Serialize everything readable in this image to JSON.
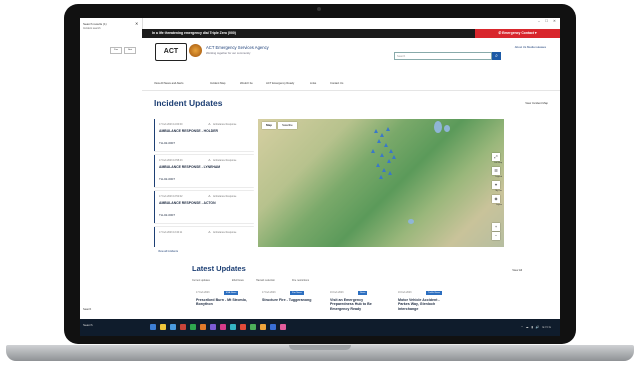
{
  "browser": {
    "left_panel_title": "Search results (1)",
    "left_panel_subtitle": "Incident search",
    "left_panel_buttons": [
      "Prev",
      "Next"
    ],
    "left_panel_footer": "Search",
    "window_controls": "– ☐ ✕"
  },
  "emergency_bar": {
    "text": "In a life threatening emergency dial Triple Zero (000)",
    "button_label": "Emergency Contact"
  },
  "header": {
    "logo_text": "ACT",
    "agency_name": "ACT Emergency Services Agency",
    "agency_tagline": "Working together for our community",
    "links": "About Us   Media releases",
    "search_placeholder": "Search"
  },
  "nav": {
    "items": [
      "View All News and Alerts",
      "Incident Map",
      "Would I be",
      "ACT Emergency Ready",
      "Links",
      "Contact Us"
    ]
  },
  "incidents": {
    "title": "Incident Updates",
    "view_all": "View Incident Map",
    "view_all_incidents": "View all Incidents",
    "cards": [
      {
        "date": "17 Feb 2023 14:00:00",
        "status": "Ambulance Response",
        "name": "AMBULANCE RESPONSE - HOLDER",
        "id": "TH-02-0007"
      },
      {
        "date": "17 Feb 2023 13:58:43",
        "status": "Ambulance Response",
        "name": "AMBULANCE RESPONSE - LYNEHAM",
        "id": "TH-02-0007"
      },
      {
        "date": "17 Feb 2023 13:52:02",
        "status": "Ambulance Response",
        "name": "AMBULANCE RESPONSE - ACTON",
        "id": "TH-02-0007"
      },
      {
        "date": "17 Feb 2023 13:40:11",
        "status": "Ambulance Response",
        "name": "",
        "id": ""
      }
    ]
  },
  "map": {
    "tabs": [
      "Map",
      "Satellite"
    ],
    "controls": [
      "Full Map",
      "Legend",
      "My Loc",
      "Layers"
    ],
    "zoom_in": "+",
    "zoom_out": "−"
  },
  "latest": {
    "title": "Latest Updates",
    "view_all": "View All",
    "filters": [
      "Current updates",
      "ESA News",
      "Hazard reduction",
      "Fire restrictions"
    ],
    "cards": [
      {
        "date": "17 Feb 2023",
        "badge": "ESA News",
        "name": "Prescribed Burn - Mt Stromlo, Bonython"
      },
      {
        "date": "17 Feb 2023",
        "badge": "Fire News",
        "name": "Structure Fire - Tuggeranong"
      },
      {
        "date": "16 Feb 2023",
        "badge": "News",
        "name": "Visit an Emergency Preparedness Hub to Be Emergency Ready"
      },
      {
        "date": "16 Feb 2023",
        "badge": "Traffic News",
        "name": "Motor Vehicle Accident - Parkes Way, Glenloch Interchange"
      }
    ]
  },
  "taskbar": {
    "start": "Search",
    "tray": "^ ☁ ▮ 🔊 ENG"
  },
  "colors": {
    "emergency_red": "#d8262c",
    "brand_blue": "#1d3f74",
    "pin_blue": "#3a78c9"
  }
}
